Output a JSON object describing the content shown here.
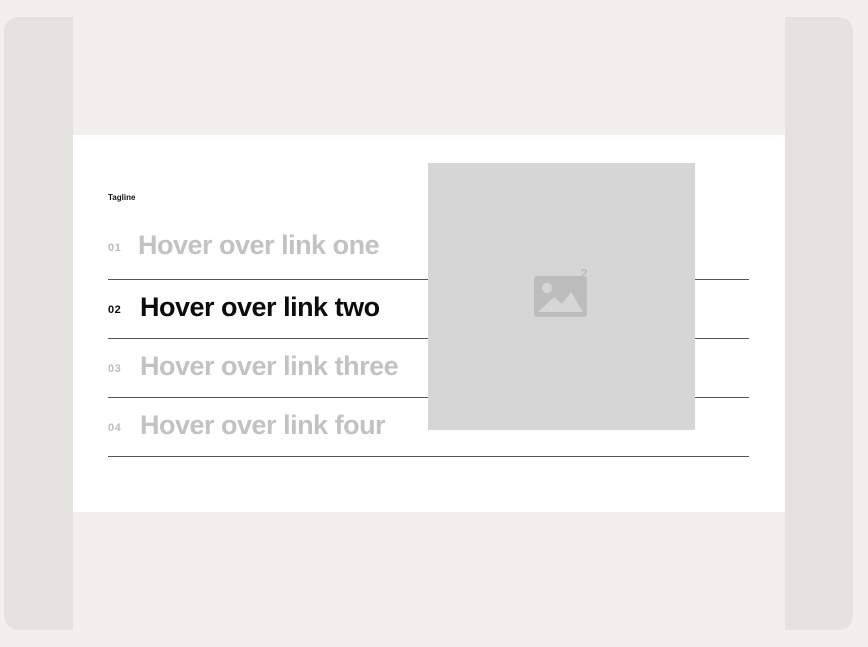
{
  "section": {
    "tagline": "Tagline",
    "links": [
      {
        "number": "01",
        "label": "Hover over link one",
        "active": false
      },
      {
        "number": "02",
        "label": "Hover over link two",
        "active": true
      },
      {
        "number": "03",
        "label": "Hover over link three",
        "active": false
      },
      {
        "number": "04",
        "label": "Hover over link four",
        "active": false
      }
    ],
    "image": {
      "icon": "image-placeholder-icon",
      "badge": "2"
    }
  }
}
